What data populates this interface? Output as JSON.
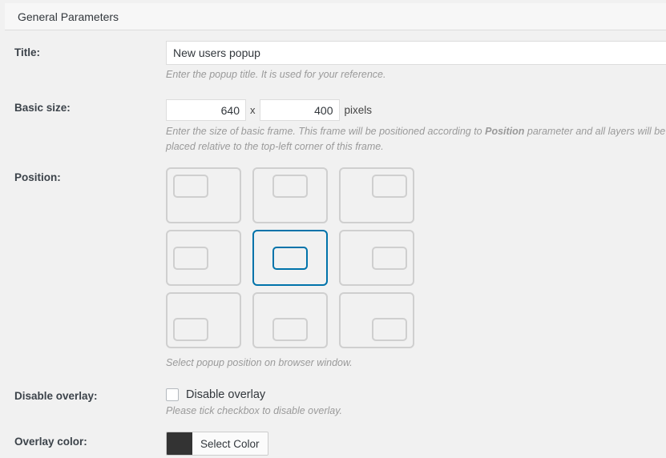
{
  "panel": {
    "header_title": "General Parameters"
  },
  "fields": {
    "title": {
      "label": "Title:",
      "value": "New users popup",
      "placeholder": "",
      "description": "Enter the popup title. It is used for your reference."
    },
    "basic_size": {
      "label": "Basic size:",
      "width_value": "640",
      "height_value": "400",
      "separator": "x",
      "unit": "pixels",
      "description_part1": "Enter the size of basic frame. This frame will be positioned according to ",
      "description_bold": "Position",
      "description_part2": " parameter and all layers will be placed relative to the top-left corner of this frame."
    },
    "position": {
      "label": "Position:",
      "description": "Select popup position on browser window.",
      "selected_index": 4,
      "cells": [
        {
          "name": "top-left",
          "h": "h-left",
          "v": "v-top"
        },
        {
          "name": "top-center",
          "h": "h-center",
          "v": "v-top"
        },
        {
          "name": "top-right",
          "h": "h-right",
          "v": "v-top"
        },
        {
          "name": "middle-left",
          "h": "h-left",
          "v": "v-middle"
        },
        {
          "name": "middle-center",
          "h": "h-center",
          "v": "v-middle"
        },
        {
          "name": "middle-right",
          "h": "h-right",
          "v": "v-middle"
        },
        {
          "name": "bottom-left",
          "h": "h-left",
          "v": "v-bottom"
        },
        {
          "name": "bottom-center",
          "h": "h-center",
          "v": "v-bottom"
        },
        {
          "name": "bottom-right",
          "h": "h-right",
          "v": "v-bottom"
        }
      ]
    },
    "disable_overlay": {
      "label": "Disable overlay:",
      "checkbox_label": "Disable overlay",
      "checked": false,
      "description": "Please tick checkbox to disable overlay."
    },
    "overlay_color": {
      "label": "Overlay color:",
      "button_label": "Select Color",
      "swatch_color": "#333333"
    }
  },
  "colors": {
    "accent": "#0073aa",
    "page_bg": "#f1f1f1",
    "panel_header_bg": "#f7f7f7",
    "border": "#dcdcdc",
    "input_border": "#dddddd",
    "label_text": "#3c434a",
    "desc_text": "#9a9a9a",
    "grid_border": "#cfcfcf"
  }
}
